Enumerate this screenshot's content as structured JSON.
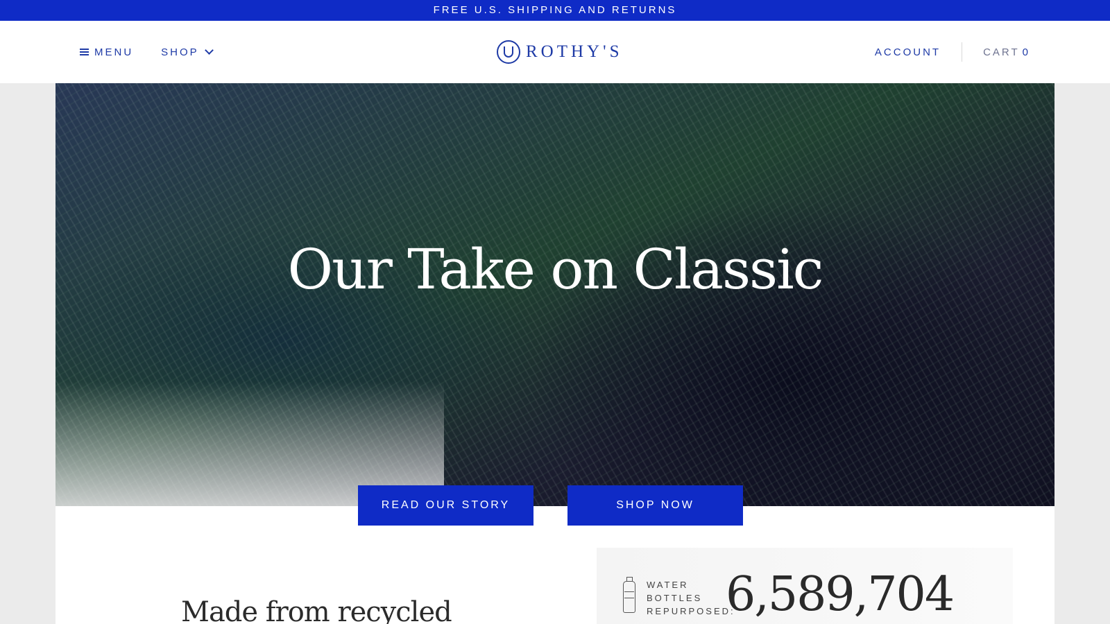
{
  "promo": {
    "text": "FREE U.S. SHIPPING AND RETURNS"
  },
  "nav": {
    "menu_label": "MENU",
    "shop_label": "SHOP",
    "logo_text": "ROTHY'S",
    "account_label": "ACCOUNT",
    "cart_label": "CART",
    "cart_count": "0"
  },
  "hero": {
    "title": "Our Take on Classic",
    "buttons": {
      "story_label": "READ OUR STORY",
      "shop_label": "SHOP NOW"
    }
  },
  "content": {
    "heading": "Made from recycled",
    "stat": {
      "label_lines": [
        "WATER",
        "BOTTLES",
        "REPURPOSED:"
      ],
      "value": "6,589,704"
    }
  },
  "colors": {
    "brand_blue": "#0f2bc6",
    "nav_text": "#1e3aa6"
  },
  "icons": [
    "hamburger-icon",
    "chevron-down-icon",
    "logo-icon",
    "water-bottle-icon"
  ]
}
